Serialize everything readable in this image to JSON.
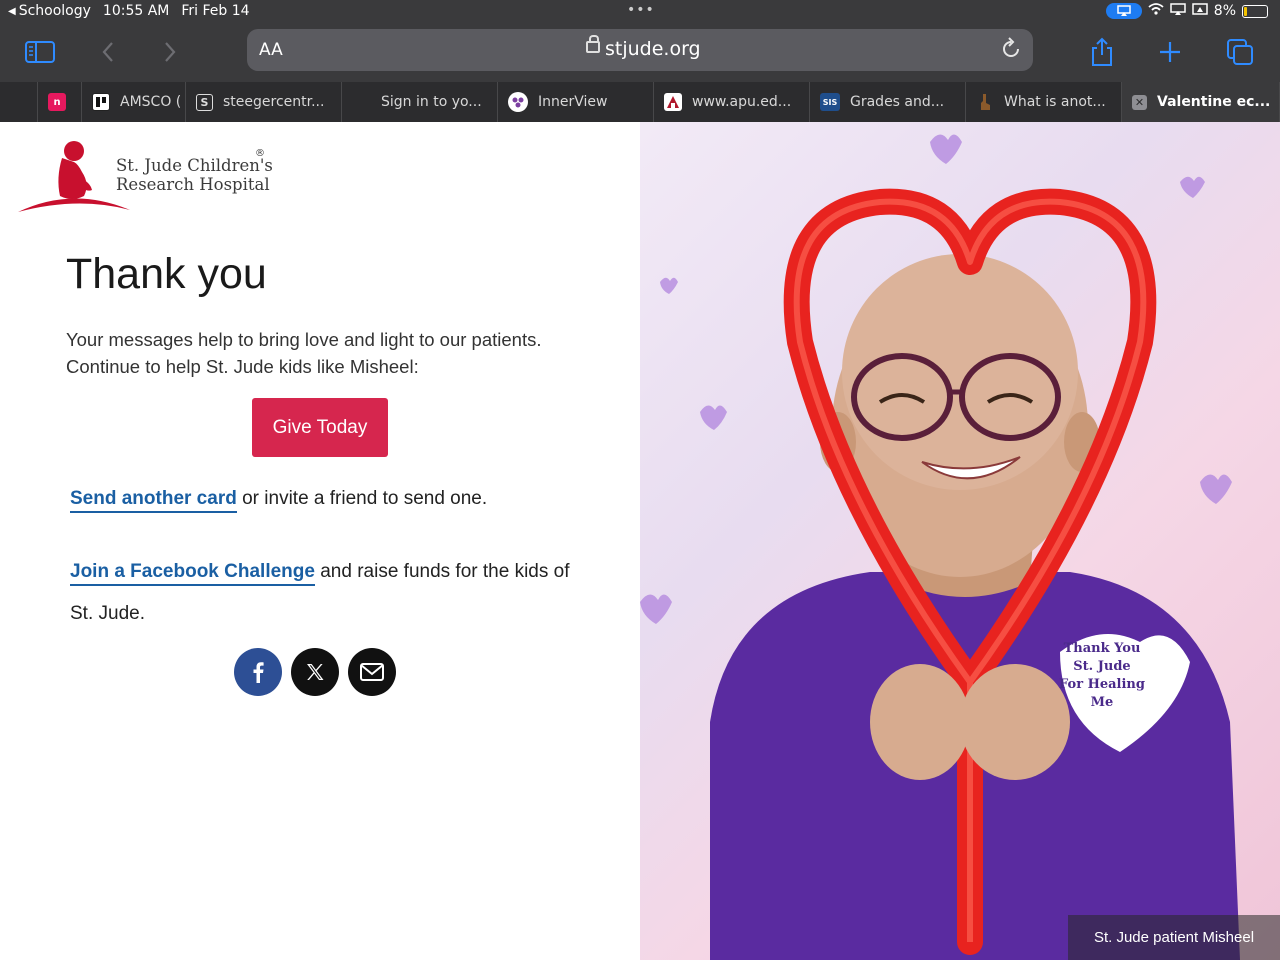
{
  "status_bar": {
    "back_app": "Schoology",
    "time": "10:55 AM",
    "date": "Fri Feb 14",
    "multitask_dots": "•••",
    "battery_percent": "8%"
  },
  "toolbar": {
    "text_size_label": "AA",
    "url": "stjude.org"
  },
  "tabs": [
    {
      "label": "",
      "favicon": "n",
      "favicon_color": "#e6195e"
    },
    {
      "label": "AMSCO (",
      "favicon": "",
      "favicon_color": "#222222"
    },
    {
      "label": "steegercentr...",
      "favicon": "S",
      "favicon_color": "#2c2c2e"
    },
    {
      "label": "Sign in to yo...",
      "favicon": "",
      "favicon_color": "#f25022"
    },
    {
      "label": "InnerView",
      "favicon": "",
      "favicon_color": "#7b3fa0"
    },
    {
      "label": "www.apu.ed...",
      "favicon": "",
      "favicon_color": "#b0182c"
    },
    {
      "label": "Grades and...",
      "favicon": "SIS",
      "favicon_color": "#1f4e8c"
    },
    {
      "label": "What is anot...",
      "favicon": "",
      "favicon_color": "#8b5a2b"
    },
    {
      "label": "Valentine ec...",
      "favicon": "✕",
      "favicon_color": "#8e8e93"
    }
  ],
  "page": {
    "logo": {
      "line1": "St. Jude Children's",
      "line2": "Research Hospital",
      "registered": "®"
    },
    "title": "Thank you",
    "message_line1": "Your messages help to bring love and light to our patients.",
    "message_line2": "Continue to help St. Jude kids like Misheel:",
    "give_button": "Give Today",
    "send_card_link": "Send another card",
    "send_card_rest": " or invite a friend to send one.",
    "facebook_link": "Join a Facebook Challenge",
    "facebook_rest": " and raise funds for the kids of St. Jude.",
    "shirt_text": [
      "Thank You",
      "St. Jude",
      "For Healing",
      "Me"
    ],
    "caption": "St. Jude patient Misheel"
  },
  "colors": {
    "give_button": "#d6264e",
    "link": "#1a5fa3",
    "facebook": "#2d4f95",
    "brand_red": "#c8102e"
  }
}
